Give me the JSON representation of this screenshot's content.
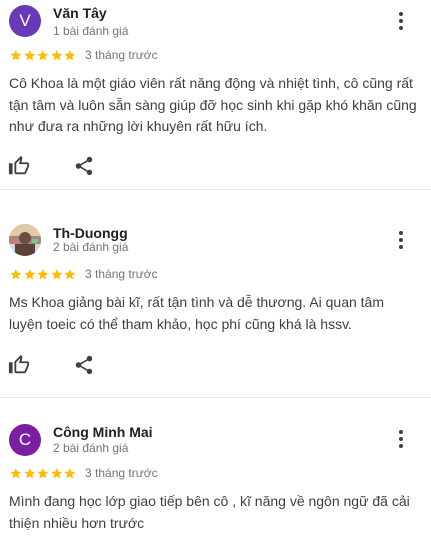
{
  "reviews": [
    {
      "initial": "V",
      "avatar_color": "#673ab7",
      "name": "Văn Tây",
      "count": "1 bài đánh giá",
      "rating": 5,
      "time": "3 tháng trước",
      "text": "Cô Khoa là một giáo viên rất năng động và nhiệt tình, cô cũng rất tận tâm và luôn sẵn sàng giúp đỡ học sinh khi gặp khó khăn cũng như đưa ra những lời khuyên rất hữu ích."
    },
    {
      "initial": "",
      "avatar_color": "#8d6e63",
      "name": "Th-Duongg",
      "count": "2 bài đánh giá",
      "rating": 5,
      "time": "3 tháng trước",
      "text": "Ms Khoa giảng bài kĩ, rất tận tình và dễ thương. Ai quan tâm luyện toeic có thể tham khảo, học phí cũng khá là hssv."
    },
    {
      "initial": "C",
      "avatar_color": "#7b1fa2",
      "name": "Công Minh Mai",
      "count": "2 bài đánh giá",
      "rating": 5,
      "time": "3 tháng trước",
      "text": "Mình đang học lớp giao tiếp bên cô , kĩ năng về ngôn ngữ đã cải thiện nhiều hơn trước"
    }
  ],
  "colors": {
    "star": "#fbbc04",
    "icon": "#3c4043"
  },
  "icons": {
    "like": "thumbs-up-icon",
    "share": "share-icon",
    "more": "more-vert-icon"
  }
}
